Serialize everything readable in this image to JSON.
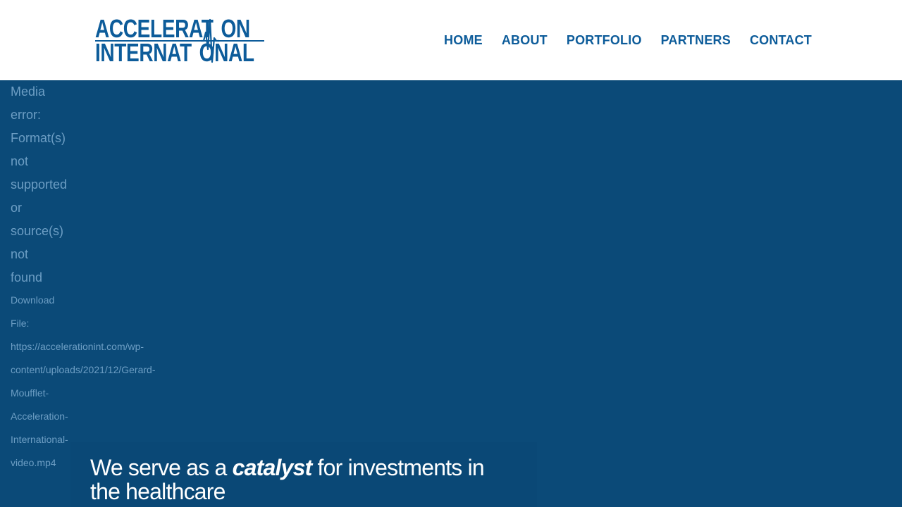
{
  "header": {
    "logo": {
      "line1_left": "ACCELERAT",
      "line1_right": "ON",
      "line2_left": "INTERNAT",
      "line2_right": "ONAL",
      "alt": "ACCELERATION INTERNATIONAL"
    },
    "nav": [
      "HOME",
      "ABOUT",
      "PORTFOLIO",
      "PARTNERS",
      "CONTACT"
    ]
  },
  "media_error": {
    "message_words": [
      "Media",
      "error:",
      "Format(s)",
      "not",
      "supported",
      "or",
      "source(s)",
      "not",
      "found"
    ],
    "download_label_words": [
      "Download",
      "File:"
    ],
    "download_url_lines": [
      "https://accelerationint.com/wp-",
      "content/uploads/2021/12/Gerard-",
      "Moufflet-",
      "Acceleration-",
      "International-",
      "video.mp4"
    ]
  },
  "hero": {
    "before": "We serve as a ",
    "emphasis": "catalyst",
    "after": " for investments in the healthcare"
  },
  "colors": {
    "brand_blue": "#0d5c9a",
    "background": "#0b4a78",
    "muted_text": "#6d9ec4"
  }
}
